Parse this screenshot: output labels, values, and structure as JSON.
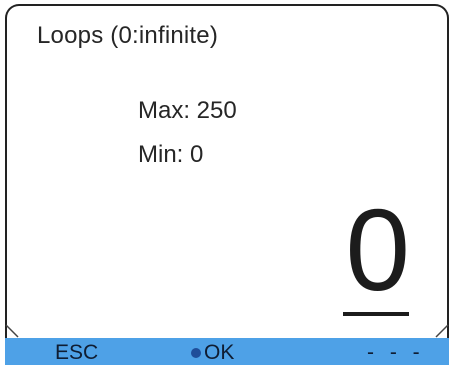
{
  "dialog": {
    "title": "Loops (0:infinite)",
    "max_label": "Max: 250",
    "min_label": "Min: 0",
    "current_value": "0"
  },
  "softkeys": {
    "left_label": "ESC",
    "center_label": "OK",
    "right_label": "- - -"
  },
  "colors": {
    "softbar": "#4ea1e7",
    "text": "#262626",
    "ok_dot": "#1f4d99"
  },
  "icons": {
    "ok_indicator": "dot-icon",
    "left_corner": "corner-chevron-icon",
    "right_corner": "corner-chevron-icon"
  }
}
